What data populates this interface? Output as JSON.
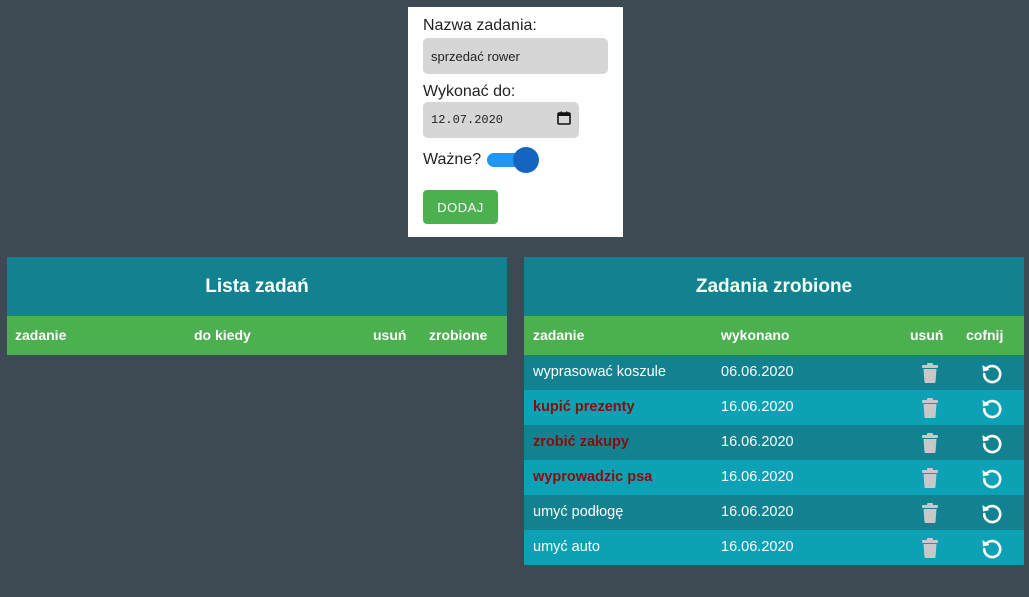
{
  "form": {
    "task_label": "Nazwa zadania:",
    "task_value": "sprzedać rower",
    "due_label": "Wykonać do:",
    "due_value": "12.07.2020",
    "important_label": "Ważne?",
    "important_on": true,
    "add_label": "DODAJ"
  },
  "todo": {
    "title": "Lista zadań",
    "columns": {
      "task": "zadanie",
      "due": "do kiedy",
      "delete": "usuń",
      "done": "zrobione"
    }
  },
  "done": {
    "title": "Zadania zrobione",
    "columns": {
      "task": "zadanie",
      "completed": "wykonano",
      "delete": "usuń",
      "undo": "cofnij"
    },
    "rows": [
      {
        "task": "wyprasować koszule",
        "date": "06.06.2020",
        "important": false
      },
      {
        "task": "kupić prezenty",
        "date": "16.06.2020",
        "important": true
      },
      {
        "task": "zrobić zakupy",
        "date": "16.06.2020",
        "important": true
      },
      {
        "task": "wyprowadzic psa",
        "date": "16.06.2020",
        "important": true
      },
      {
        "task": "umyć podłogę",
        "date": "16.06.2020",
        "important": false
      },
      {
        "task": "umyć auto",
        "date": "16.06.2020",
        "important": false
      }
    ]
  },
  "icons": {
    "delete": "trash-icon",
    "undo": "undo-icon",
    "calendar": "calendar-icon"
  },
  "colors": {
    "background": "#3d4a54",
    "panel_title": "#138290",
    "header_row": "#4caf50",
    "row_alt": "#0ca1b5",
    "important_text": "#8b0a0a",
    "toggle": "#2196f3"
  }
}
